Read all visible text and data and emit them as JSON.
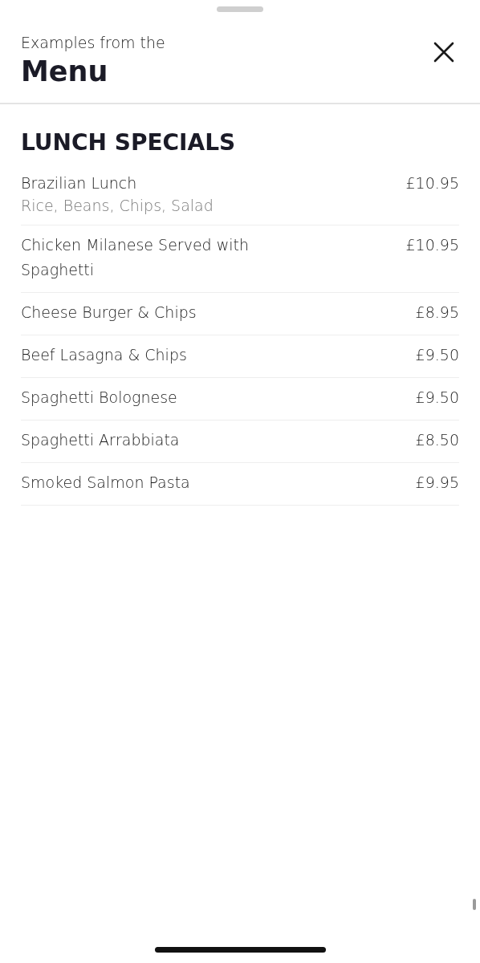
{
  "header": {
    "subtitle": "Examples from the",
    "title": "Menu"
  },
  "section": {
    "title": "LUNCH SPECIALS",
    "items": [
      {
        "name": "Brazilian Lunch",
        "description": "Rice, Beans, Chips, Salad",
        "price": "£10.95"
      },
      {
        "name": "Chicken Milanese Served with Spaghetti",
        "price": "£10.95"
      },
      {
        "name": "Cheese Burger & Chips",
        "price": "£8.95"
      },
      {
        "name": "Beef Lasagna & Chips",
        "price": "£9.50"
      },
      {
        "name": "Spaghetti Bolognese",
        "price": "£9.50"
      },
      {
        "name": "Spaghetti Arrabbiata",
        "price": "£8.50"
      },
      {
        "name": "Smoked Salmon Pasta",
        "price": "£9.95"
      }
    ]
  }
}
